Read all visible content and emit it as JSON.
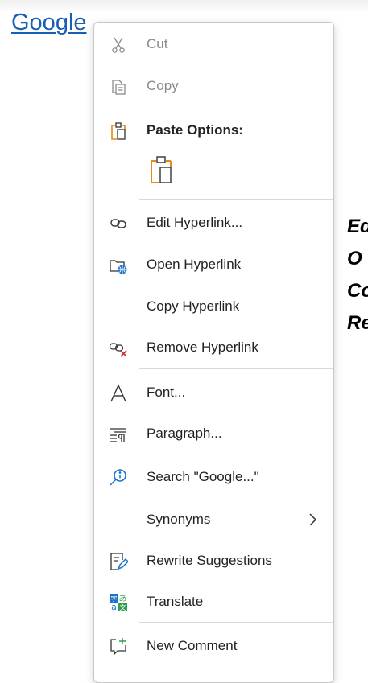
{
  "document": {
    "link_text": "Google",
    "right_text": [
      "Ed",
      "O",
      "Co",
      "Re"
    ]
  },
  "colors": {
    "link": "#1a5fb4",
    "clipboard_orange": "#e8891b",
    "accent_blue": "#1a73c8",
    "remove_red": "#d13438"
  },
  "context_menu": {
    "items": {
      "cut": {
        "label": "Cut",
        "icon": "scissors-icon",
        "enabled": false
      },
      "copy": {
        "label": "Copy",
        "icon": "copy-icon",
        "enabled": false
      },
      "paste_options": {
        "label": "Paste Options:",
        "icon": "clipboard-icon"
      },
      "paste_keep_source": {
        "icon": "paste-keep-formatting-icon"
      },
      "edit_hyperlink": {
        "label": "Edit Hyperlink...",
        "icon": "edit-link-icon"
      },
      "open_hyperlink": {
        "label": "Open Hyperlink",
        "icon": "open-link-icon"
      },
      "copy_hyperlink": {
        "label": "Copy Hyperlink"
      },
      "remove_hyperlink": {
        "label": "Remove Hyperlink",
        "icon": "remove-link-icon"
      },
      "font": {
        "label": "Font...",
        "icon": "font-icon"
      },
      "paragraph": {
        "label": "Paragraph...",
        "icon": "paragraph-icon"
      },
      "search": {
        "label": "Search \"Google...\"",
        "icon": "smart-lookup-icon"
      },
      "synonyms": {
        "label": "Synonyms",
        "has_submenu": true
      },
      "rewrite": {
        "label": "Rewrite Suggestions",
        "icon": "rewrite-icon"
      },
      "translate": {
        "label": "Translate",
        "icon": "translate-icon"
      },
      "new_comment": {
        "label": "New Comment",
        "icon": "new-comment-icon"
      }
    }
  }
}
